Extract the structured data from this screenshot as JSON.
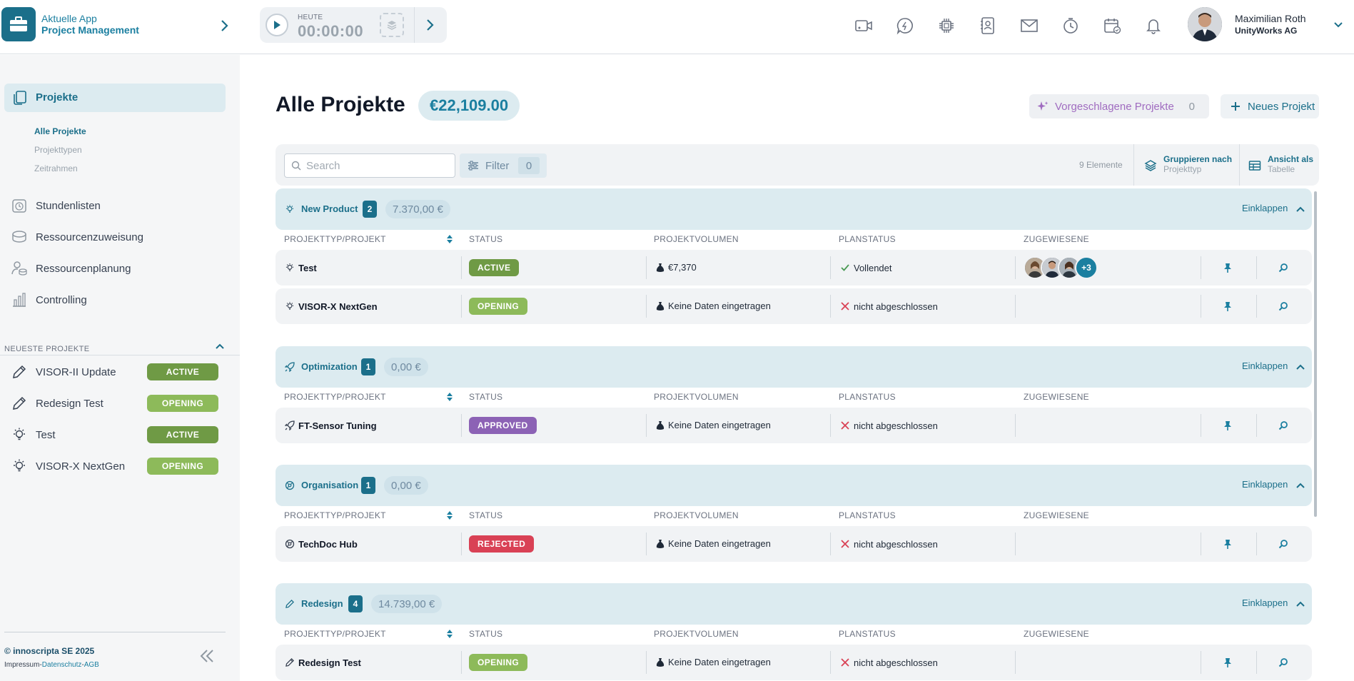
{
  "app": {
    "line1": "Aktuelle App",
    "line2": "Project Management"
  },
  "timer": {
    "label": "HEUTE",
    "time": "00:00:00"
  },
  "header_icons": [
    "video-icon",
    "chat-icon",
    "chip-icon",
    "contacts-icon",
    "mail-icon",
    "clock-icon",
    "calendar-icon",
    "bell-icon"
  ],
  "user": {
    "name": "Maximilian Roth",
    "company": "UnityWorks AG"
  },
  "sidebar": {
    "active": "Projekte",
    "subnav": [
      "Alle Projekte",
      "Projekttypen",
      "Zeitrahmen"
    ],
    "items": [
      "Stundenlisten",
      "Ressourcenzuweisung",
      "Ressourcenplanung",
      "Controlling"
    ],
    "recent_title": "NEUESTE PROJEKTE",
    "recent": [
      {
        "name": "VISOR-II Update",
        "status": "ACTIVE"
      },
      {
        "name": "Redesign Test",
        "status": "OPENING"
      },
      {
        "name": "Test",
        "status": "ACTIVE"
      },
      {
        "name": "VISOR-X NextGen",
        "status": "OPENING"
      }
    ],
    "copyright": "© innoscripta SE 2025",
    "legal": {
      "impressum": "Impressum",
      "sep": "-",
      "datenschutz": "Datenschutz",
      "agb": "AGB"
    }
  },
  "main": {
    "title": "Alle Projekte",
    "total": "€22,109.00",
    "suggest": {
      "label": "Vorgeschlagene Projekte",
      "count": "0"
    },
    "new_project": "Neues Projekt",
    "search_placeholder": "Search",
    "filter": {
      "label": "Filter",
      "count": "0"
    },
    "elements": "9 Elemente",
    "group_by": {
      "label": "Gruppieren nach",
      "value": "Projekttyp"
    },
    "view_as": {
      "label": "Ansicht als",
      "value": "Tabelle"
    },
    "collapse_label": "Einklappen",
    "columns": [
      "PROJEKTTYP/PROJEKT",
      "STATUS",
      "PROJEKTVOLUMEN",
      "PLANSTATUS",
      "ZUGEWIESENE"
    ],
    "groups": [
      {
        "name": "New Product",
        "count": "2",
        "sum": "7.370,00 €",
        "rows": [
          {
            "name": "Test",
            "status": "ACTIVE",
            "volume": "€7,370",
            "plan": "Vollendet",
            "plan_ok": true,
            "assignees_more": "+3"
          },
          {
            "name": "VISOR-X NextGen",
            "status": "OPENING",
            "volume": "Keine Daten eingetragen",
            "plan": "nicht abgeschlossen",
            "plan_ok": false
          }
        ]
      },
      {
        "name": "Optimization",
        "count": "1",
        "sum": "0,00 €",
        "rows": [
          {
            "name": "FT-Sensor Tuning",
            "status": "APPROVED",
            "volume": "Keine Daten eingetragen",
            "plan": "nicht abgeschlossen",
            "plan_ok": false
          }
        ]
      },
      {
        "name": "Organisation",
        "count": "1",
        "sum": "0,00 €",
        "rows": [
          {
            "name": "TechDoc Hub",
            "status": "REJECTED",
            "volume": "Keine Daten eingetragen",
            "plan": "nicht abgeschlossen",
            "plan_ok": false
          }
        ]
      },
      {
        "name": "Redesign",
        "count": "4",
        "sum": "14.739,00 €",
        "rows": [
          {
            "name": "Redesign Test",
            "status": "OPENING",
            "volume": "Keine Daten eingetragen",
            "plan": "nicht abgeschlossen",
            "plan_ok": false
          }
        ]
      }
    ]
  },
  "colors": {
    "brand": "#1b6f8a",
    "active": "#6f9a45",
    "opening": "#8dba5a",
    "approved": "#8c62b5",
    "rejected": "#d94155"
  }
}
